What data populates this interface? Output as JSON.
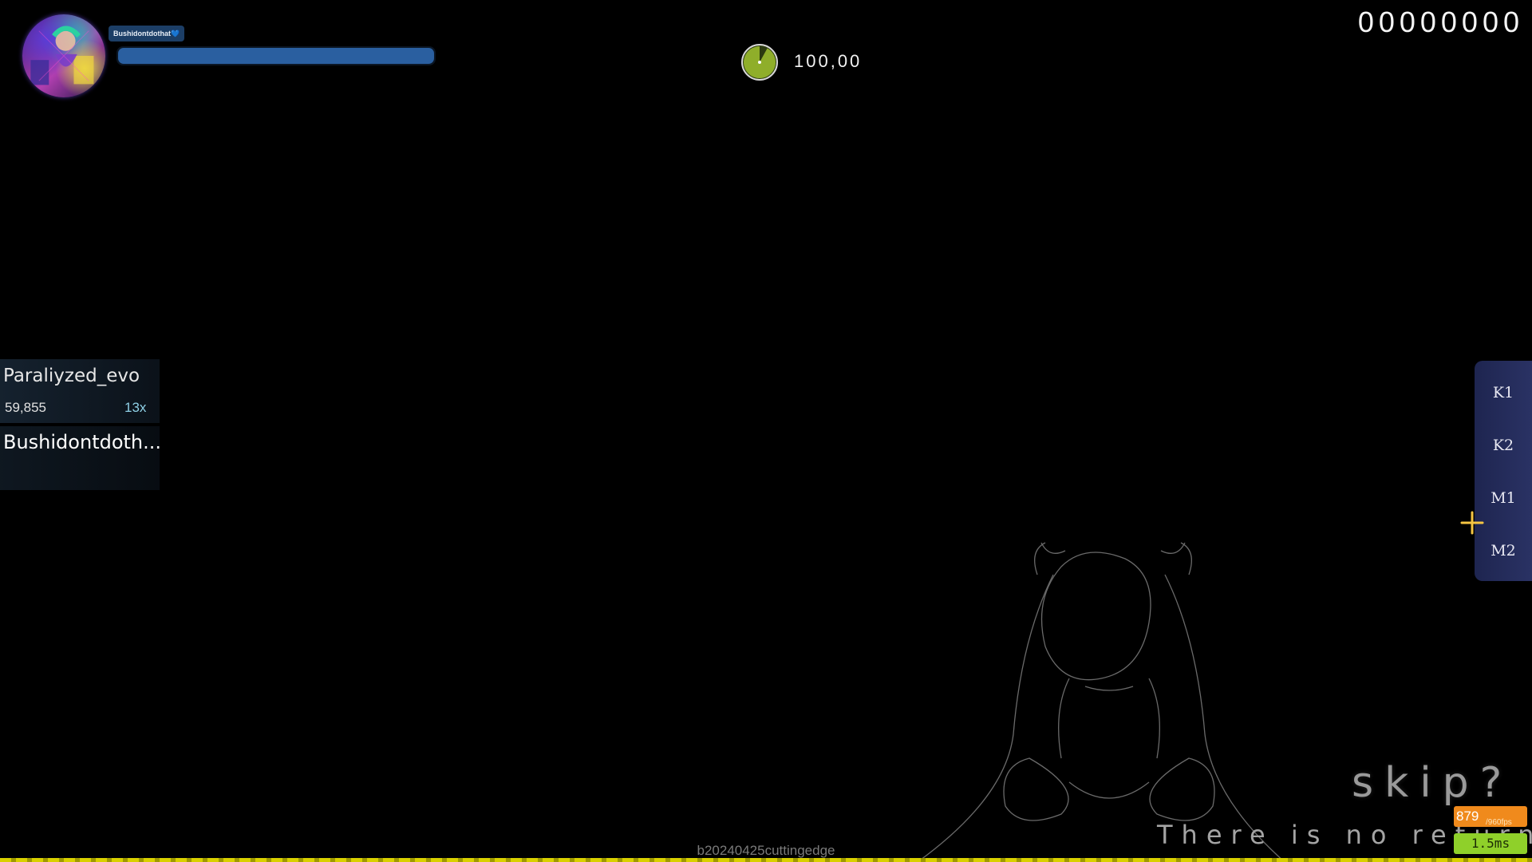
{
  "player": {
    "name": "Bushidontdothat💙",
    "health_fraction": 1.0
  },
  "hud": {
    "accuracy": "100,00",
    "score": "00000000",
    "song_progress_fraction": 0.08
  },
  "leaderboard": {
    "entries": [
      {
        "name": "Paraliyzed_evo",
        "score": "59,855",
        "combo": "13x"
      },
      {
        "name": "Bushidontdoth..."
      }
    ]
  },
  "key_overlay": {
    "keys": [
      "K1",
      "K2",
      "M1",
      "M2"
    ]
  },
  "skip": {
    "label": "skip?",
    "tagline": "There is no return"
  },
  "performance": {
    "fps": "879",
    "fps_target": "/960fps",
    "frame_time": "1.5ms"
  },
  "build_version": "b20240425cuttingedge",
  "colors": {
    "health_bar": "#2a5fa0",
    "timer_pie": "#8fae2a",
    "fps_badge": "#f08a1c",
    "frame_time_badge": "#8fd02a",
    "progress_stripe": "#d9d000",
    "key_overlay_bg": "#252c5a",
    "cursor": "#f5c542"
  },
  "icons": {
    "avatar": "player-avatar",
    "timer": "song-timer-pie-icon",
    "cursor": "cursor-crosshair-icon"
  }
}
